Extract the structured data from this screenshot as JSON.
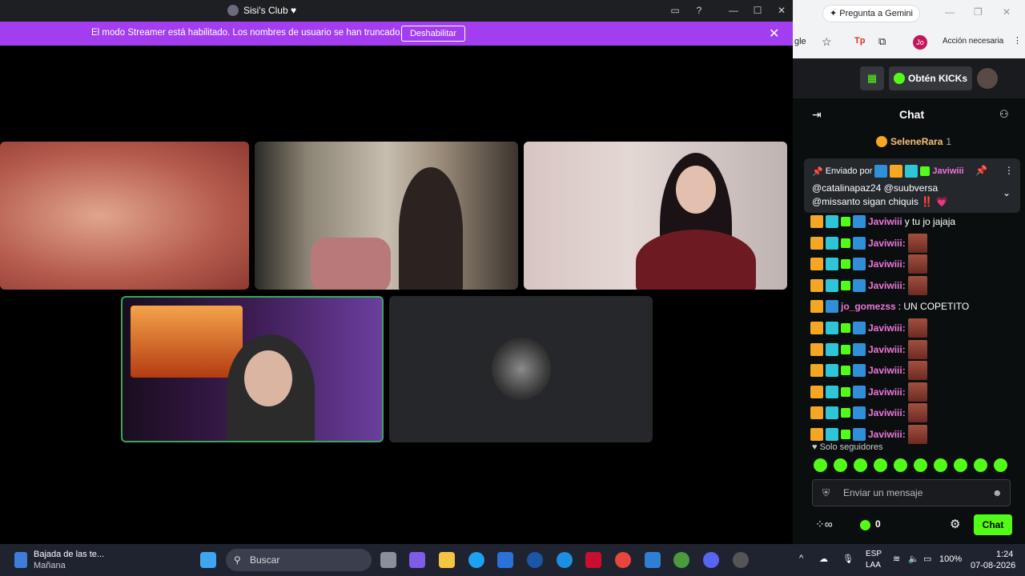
{
  "discord": {
    "title": "Sisi's Club ♥",
    "streamer_msg": "El modo Streamer está habilitado. Los nombres de usuario se han truncado.",
    "disable_btn": "Deshabilitar"
  },
  "browser": {
    "gemini": "Pregunta a Gemini",
    "addr_frag": "gle",
    "profile": "Jo",
    "action": "Acción necesaria"
  },
  "kick": {
    "get_kicks": "Obtén KICKs",
    "chat_title": "Chat",
    "top_user": "SeleneRara",
    "top_count": "1",
    "pinned_by": "Enviado por",
    "pinned_user": "Javiwiii",
    "pinned_line1": "@catalinapaz24 @suubversa",
    "pinned_line2": "@missanto sigan chiquis ‼️ 💗",
    "lines": [
      {
        "user": "Javiwiii",
        "text": "y tu jo jajaja",
        "emote": false
      },
      {
        "user": "Javiwiii:",
        "text": "",
        "emote": true
      },
      {
        "user": "Javiwiii:",
        "text": "",
        "emote": true
      },
      {
        "user": "Javiwiii:",
        "text": "",
        "emote": true
      },
      {
        "user": "jo_gomezss",
        "text": ": UN COPETITO",
        "emote": false
      },
      {
        "user": "Javiwiii:",
        "text": "",
        "emote": true
      },
      {
        "user": "Javiwiii:",
        "text": "",
        "emote": true
      },
      {
        "user": "Javiwiii:",
        "text": "",
        "emote": true
      },
      {
        "user": "Javiwiii:",
        "text": "",
        "emote": true
      },
      {
        "user": "Javiwiii:",
        "text": "",
        "emote": true
      },
      {
        "user": "Javiwiii:",
        "text": "",
        "emote": true
      }
    ],
    "followers_only": "Solo seguidores",
    "input_placeholder": "Enviar un mensaje",
    "kick_count": "0",
    "send_label": "Chat"
  },
  "taskbar": {
    "weather_title": "Bajada de las te...",
    "weather_sub": "Mañana",
    "search": "Buscar",
    "lang1": "ESP",
    "lang2": "LAA",
    "battery": "100%",
    "time": "1:24",
    "date": "07-08-2026"
  }
}
